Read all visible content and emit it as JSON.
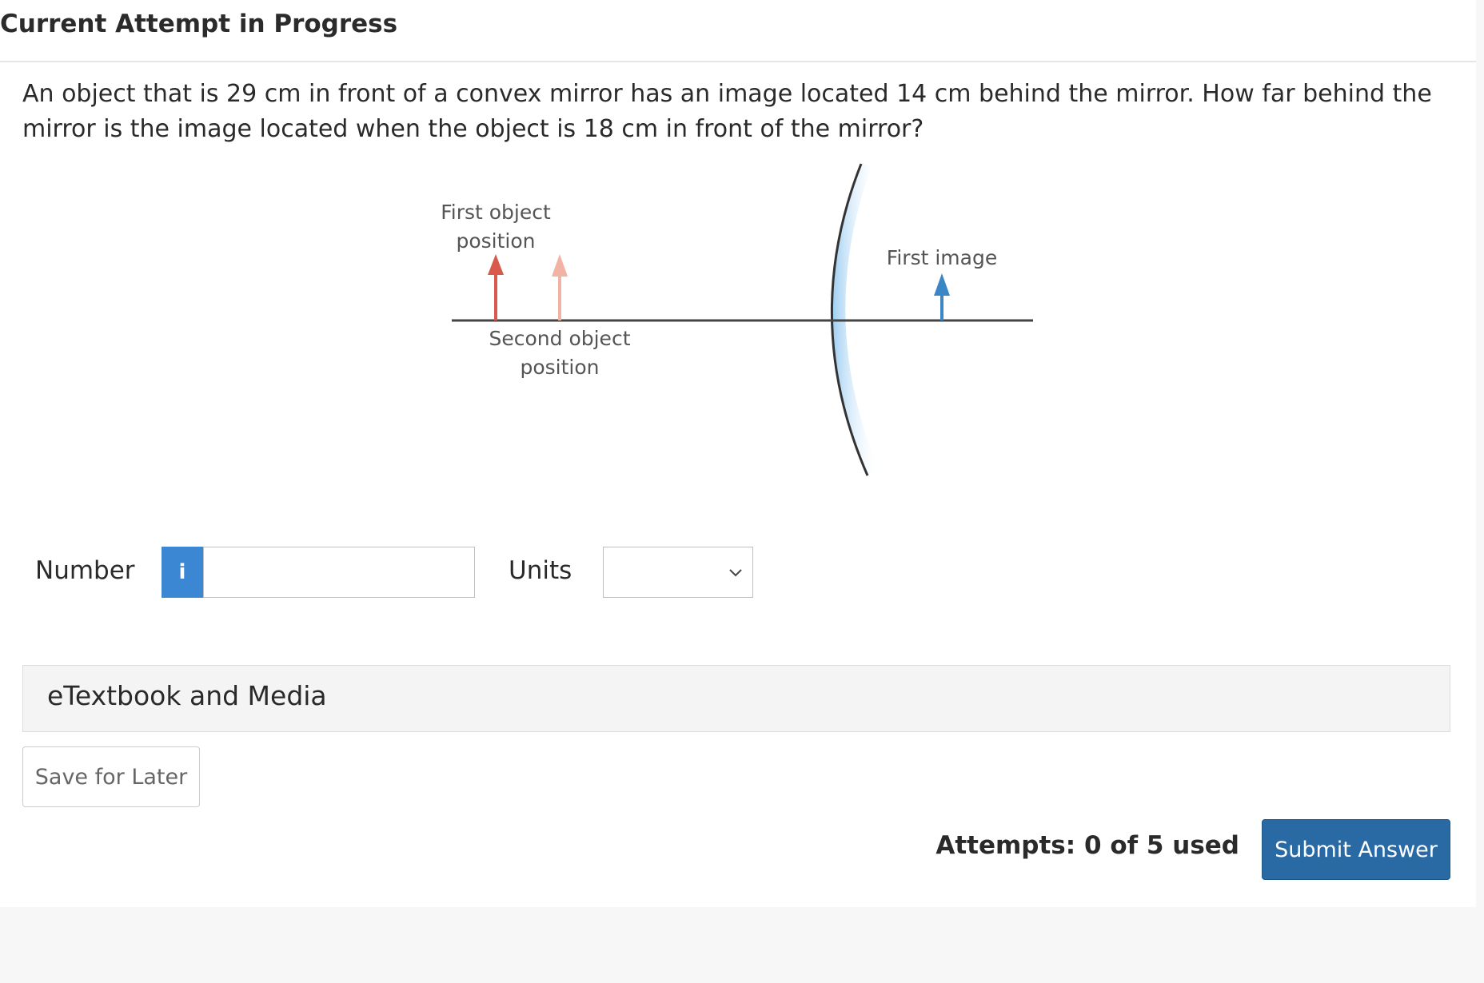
{
  "header": {
    "title": "Current Attempt in Progress"
  },
  "question": {
    "text": "An object that is 29 cm in front of a convex mirror has an image located 14 cm behind the mirror. How far behind the mirror is the image located when the object is 18 cm in front of the mirror?"
  },
  "diagram": {
    "first_object_line1": "First object",
    "first_object_line2": "position",
    "second_object_line1": "Second object",
    "second_object_line2": "position",
    "first_image": "First image",
    "colors": {
      "first_object": "#d9594c",
      "second_object": "#f2b3a4",
      "image": "#3b87c6",
      "mirror": "#bfdff7"
    }
  },
  "answer": {
    "number_label": "Number",
    "info_icon": "i",
    "number_value": "",
    "units_label": "Units",
    "units_selected": ""
  },
  "etextbook": {
    "label": "eTextbook and Media"
  },
  "actions": {
    "save_label": "Save for Later",
    "attempts_text": "Attempts: 0 of 5 used",
    "submit_label": "Submit Answer"
  }
}
